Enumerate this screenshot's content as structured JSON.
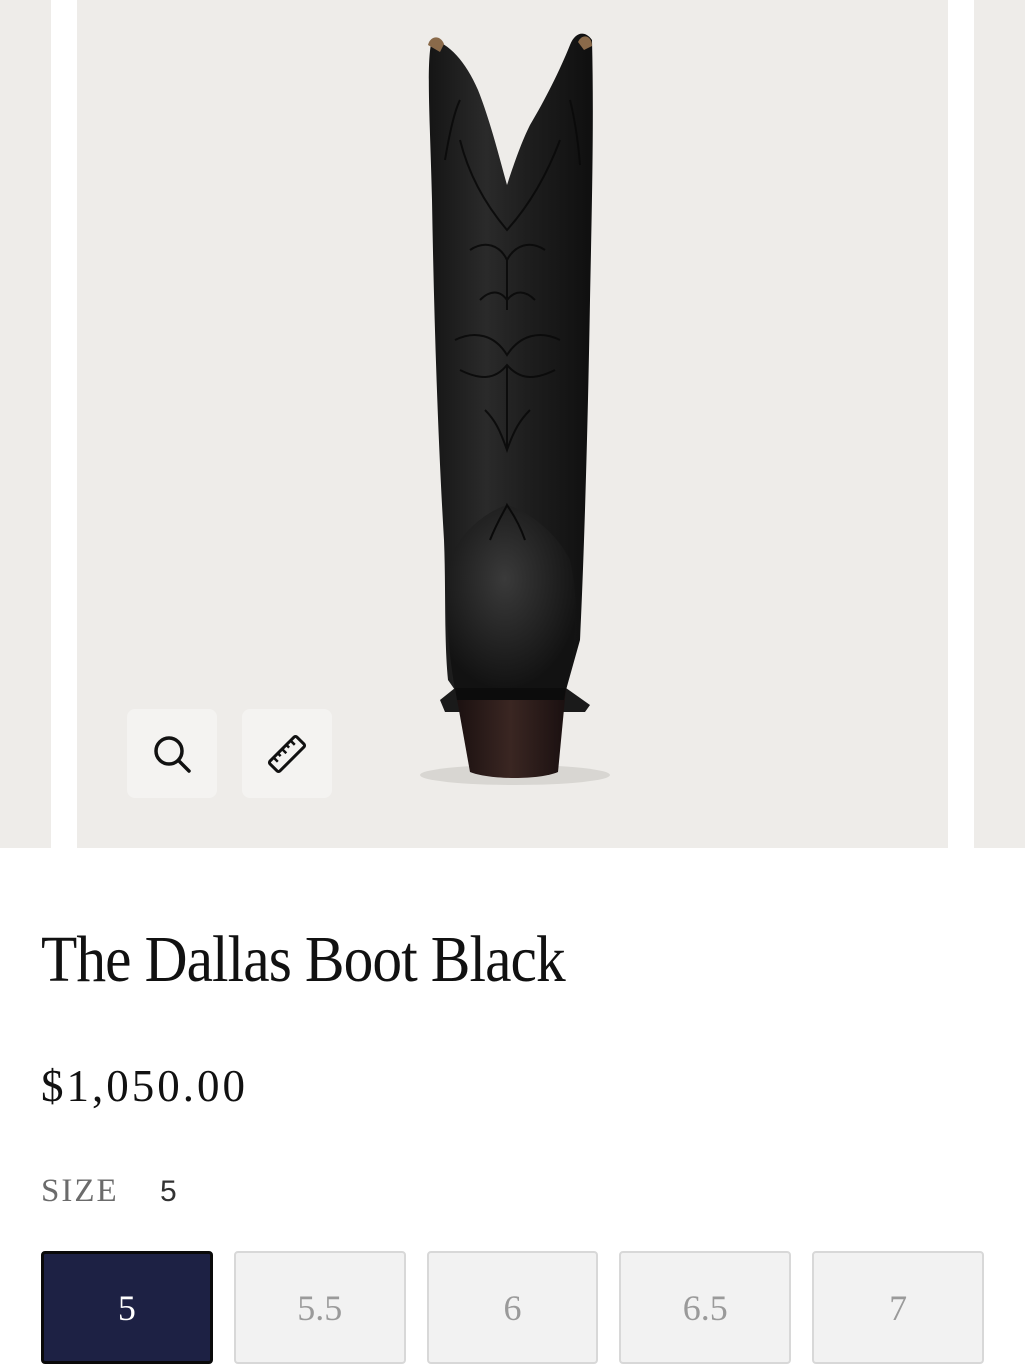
{
  "gallery": {
    "zoom_icon": "magnifier-icon",
    "size_guide_icon": "ruler-icon",
    "image_alt": "Black leather western boot, back view"
  },
  "product": {
    "title": "The Dallas Boot Black",
    "price": "$1,050.00"
  },
  "size": {
    "label": "SIZE",
    "selected_value": "5",
    "options": [
      {
        "label": "5",
        "selected": true
      },
      {
        "label": "5.5",
        "selected": false
      },
      {
        "label": "6",
        "selected": false
      },
      {
        "label": "6.5",
        "selected": false
      },
      {
        "label": "7",
        "selected": false
      }
    ]
  },
  "colors": {
    "selected_bg": "#1d2144",
    "gallery_bg": "#eeece9"
  }
}
